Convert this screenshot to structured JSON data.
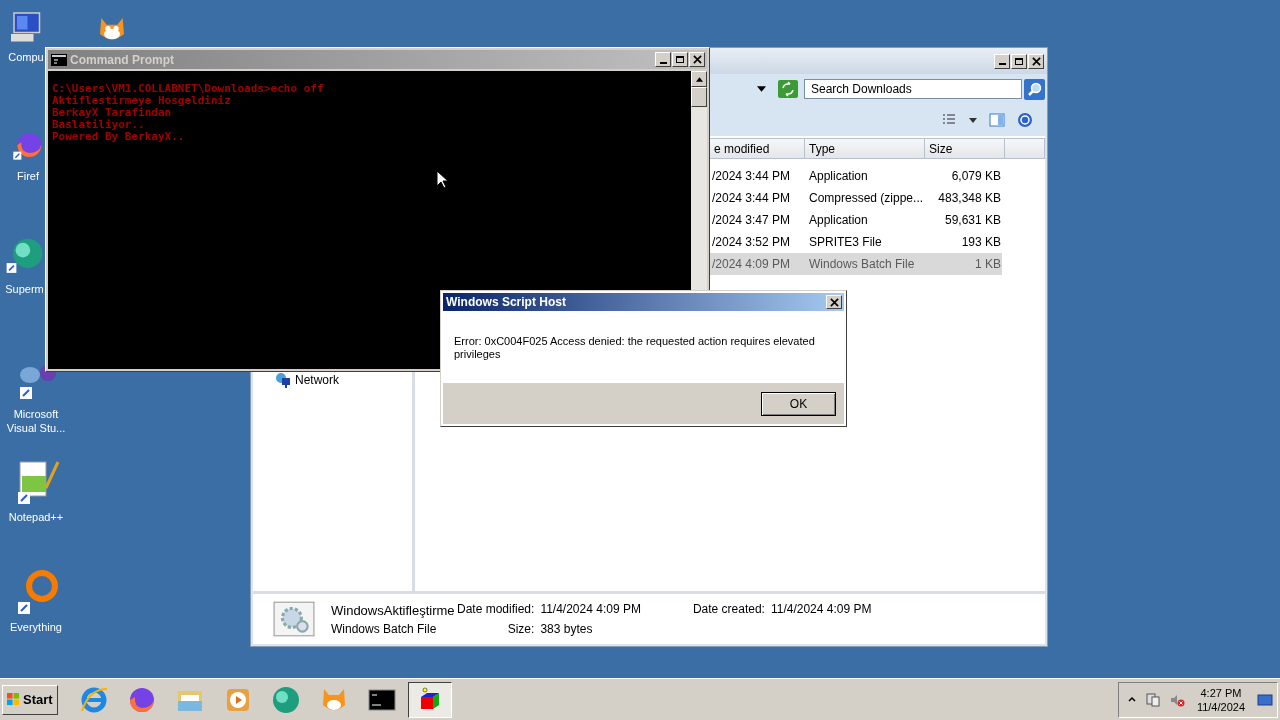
{
  "desktop_icons": [
    {
      "kind": "computer",
      "label": "Compu"
    },
    {
      "kind": "scratch"
    },
    {
      "kind": "firefox",
      "label": "Firef"
    },
    {
      "kind": "supermium",
      "label": "Superm"
    },
    {
      "kind": "visualstudio",
      "label": "Microsoft Visual Stu..."
    },
    {
      "kind": "notepad",
      "label": "Notepad++"
    },
    {
      "kind": "everything",
      "label": "Everything"
    }
  ],
  "explorer": {
    "search": {
      "placeholder": "Search Downloads"
    },
    "columns": [
      "e modified",
      "Type",
      "Size"
    ],
    "rows": [
      {
        "date": "/2024 3:44 PM",
        "type": "Application",
        "size": "6,079 KB",
        "selected": false
      },
      {
        "date": "/2024 3:44 PM",
        "type": "Compressed (zippe...",
        "size": "483,348 KB",
        "selected": false
      },
      {
        "date": "/2024 3:47 PM",
        "type": "Application",
        "size": "59,631 KB",
        "selected": false
      },
      {
        "date": "/2024 3:52 PM",
        "type": "SPRITE3 File",
        "size": "193 KB",
        "selected": false
      },
      {
        "date": "/2024 4:09 PM",
        "type": "Windows Batch File",
        "size": "1 KB",
        "selected": true
      }
    ],
    "nav_items": [
      {
        "label": "Network"
      }
    ],
    "details": {
      "name": "WindowsAktifleştirme",
      "type": "Windows Batch File",
      "modified_label": "Date modified:",
      "modified": "11/4/2024 4:09 PM",
      "created_label": "Date created:",
      "created": "11/4/2024 4:09 PM",
      "size_label": "Size:",
      "size": "383 bytes"
    }
  },
  "command_prompt": {
    "title": "Command Prompt",
    "lines": [
      "C:\\Users\\VM1.COLLABNET\\Downloads>echo off",
      "Aktiflestirmeye Hosgeldiniz",
      "BerkayX Tarafindan",
      "Baslatiliyor..",
      "Powered By BerkayX.."
    ]
  },
  "dialog": {
    "title": "Windows Script Host",
    "message": "Error: 0xC004F025 Access denied: the requested action requires elevated privileges",
    "button": "OK"
  },
  "taskbar": {
    "start": "Start",
    "apps": [
      {
        "kind": "ie",
        "active": false
      },
      {
        "kind": "firefox",
        "active": false
      },
      {
        "kind": "folder",
        "active": false
      },
      {
        "kind": "media",
        "active": false
      },
      {
        "kind": "supermium",
        "active": false
      },
      {
        "kind": "scratch",
        "active": false
      },
      {
        "kind": "cmd",
        "active": false
      },
      {
        "kind": "cube",
        "active": true
      }
    ],
    "time": "4:27 PM",
    "date": "11/4/2024"
  }
}
